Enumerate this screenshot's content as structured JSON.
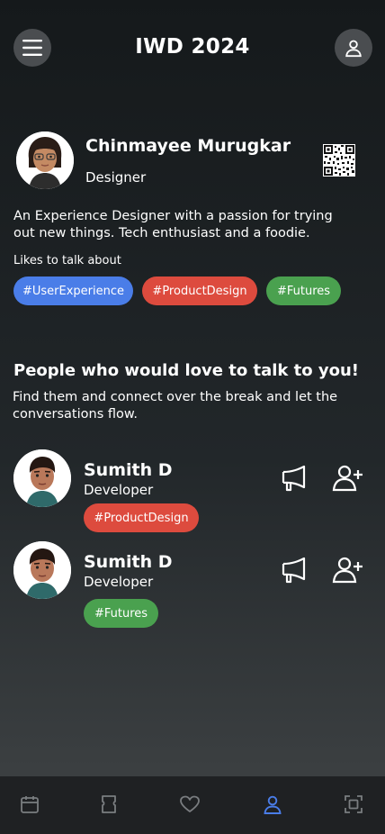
{
  "header": {
    "title": "IWD 2024",
    "menu_icon": "hamburger-icon",
    "account_icon": "user-icon"
  },
  "profile": {
    "name": "Chinmayee Murugkar",
    "role": "Designer",
    "bio": "An Experience Designer with a passion for trying out new things. Tech enthusiast and a foodie.",
    "likes_label": "Likes to talk about",
    "tags": [
      "#UserExperience",
      "#ProductDesign",
      "#Futures"
    ]
  },
  "section": {
    "title": "People who would love to talk to you!",
    "subtitle": "Find them and connect over the break and let the conversations flow."
  },
  "people": [
    {
      "name": "Sumith D",
      "role": "Developer",
      "tag": "#ProductDesign",
      "tag_color": "#dd4b3e"
    },
    {
      "name": "Sumith D",
      "role": "Developer",
      "tag": "#Futures",
      "tag_color": "#4aa14f"
    }
  ],
  "nav": {
    "items": [
      "calendar-icon",
      "ticket-icon",
      "heart-icon",
      "user-icon",
      "scan-icon"
    ],
    "active": "user-icon",
    "active_color": "#4a7de8"
  },
  "colors": {
    "blue": "#4a7de8",
    "red": "#dd4b3e",
    "green": "#4aa14f"
  }
}
